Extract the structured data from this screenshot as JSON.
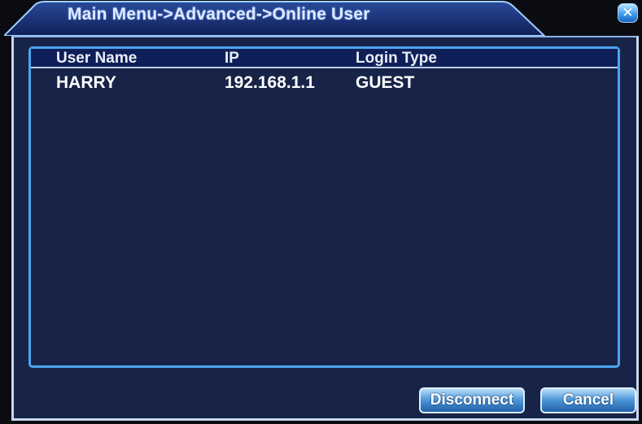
{
  "window": {
    "title": "Main Menu->Advanced->Online User",
    "close_label": "✕"
  },
  "table": {
    "headers": [
      "User Name",
      "IP",
      "Login Type"
    ],
    "rows": [
      {
        "user_name": "HARRY",
        "ip": "192.168.1.1",
        "login_type": "GUEST"
      }
    ]
  },
  "buttons": {
    "disconnect": "Disconnect",
    "cancel": "Cancel"
  },
  "colors": {
    "panel_bg": "#172448",
    "border_accent": "#4da4f0",
    "text": "#ffffff"
  }
}
